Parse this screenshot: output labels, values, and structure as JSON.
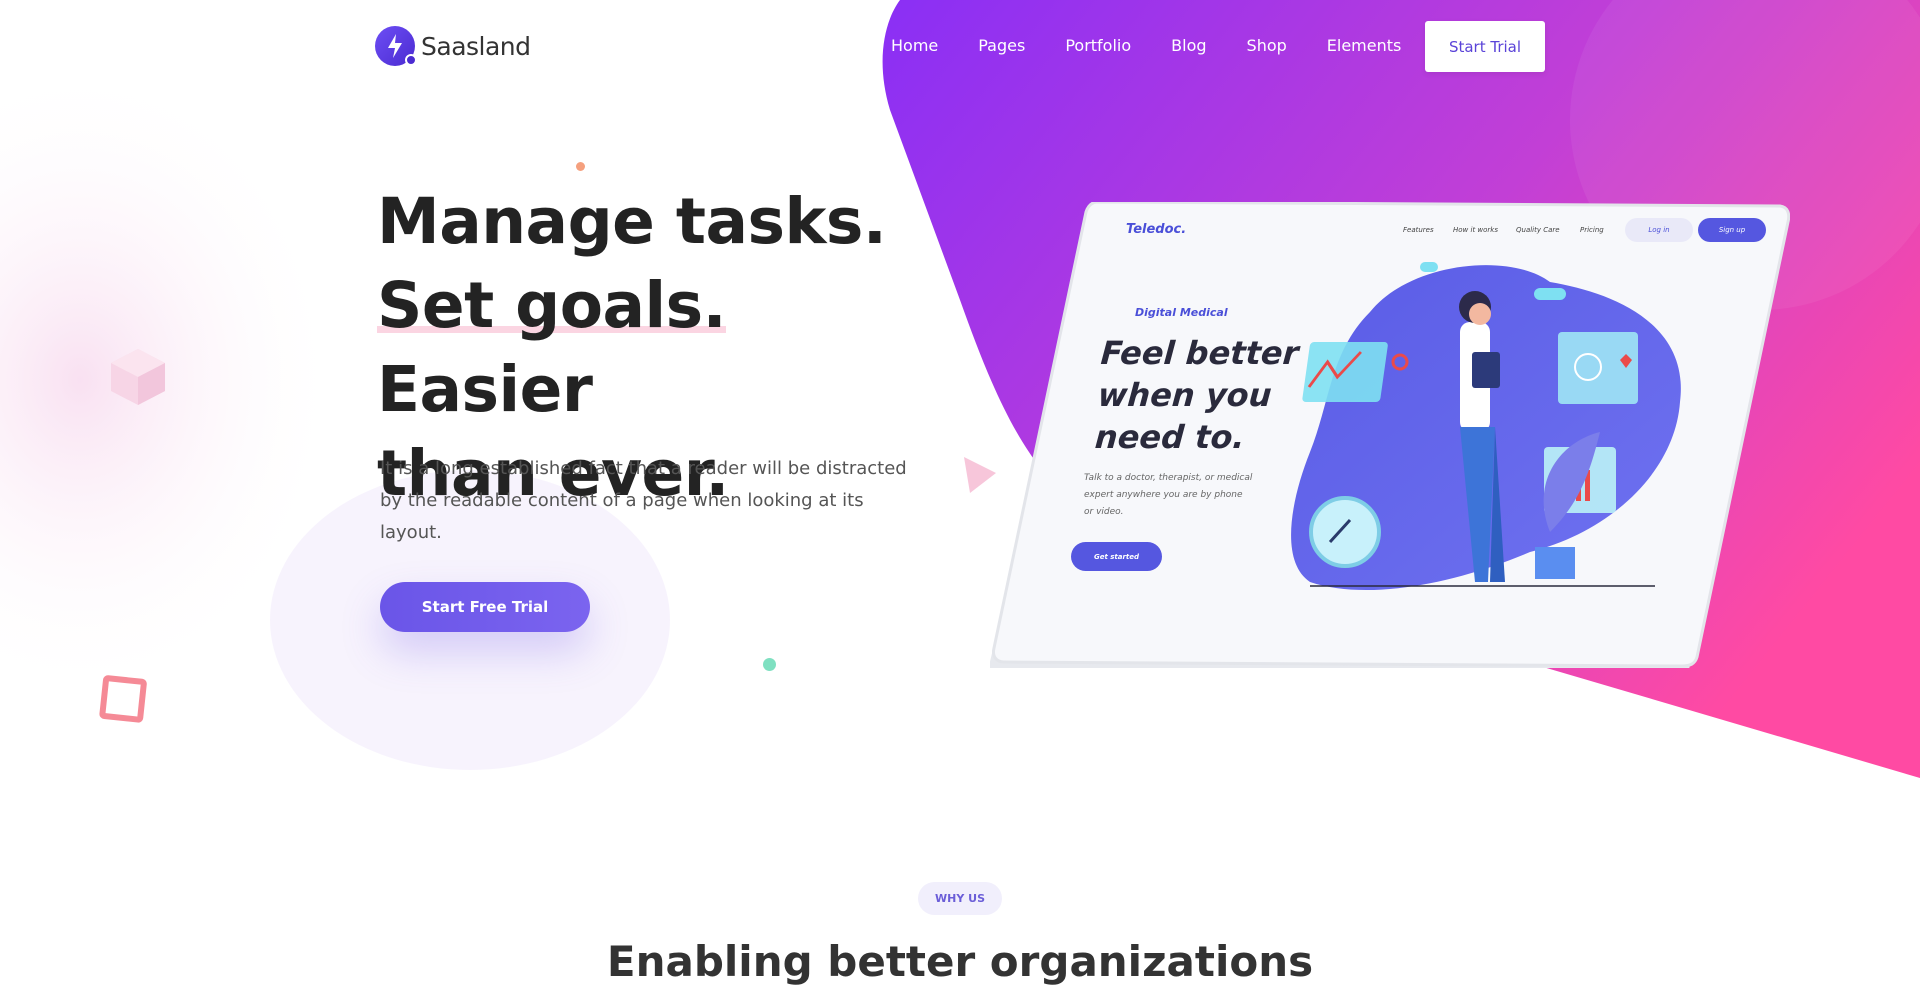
{
  "brand": {
    "name": "Saasland",
    "icon": "lightning-bolt-icon"
  },
  "nav": {
    "items": [
      "Home",
      "Pages",
      "Portfolio",
      "Blog",
      "Shop",
      "Elements"
    ],
    "cta": "Start Trial"
  },
  "hero": {
    "title_line1": "Manage tasks.",
    "title_highlight": "Set goals.",
    "title_line2_rest": " Easier",
    "title_line3": "than ever.",
    "description": "It is a long established fact that a reader will be distracted by the readable content of a page when looking at its layout.",
    "cta": "Start Free Trial"
  },
  "mockup": {
    "logo": "Teledoc.",
    "nav": [
      "Features",
      "How it works",
      "Quality Care",
      "Pricing"
    ],
    "login": "Log in",
    "signup": "Sign up",
    "kicker": "Digital Medical",
    "title": "Feel better when you need to.",
    "subtitle": "Talk to a doctor, therapist, or medical expert anywhere you are by phone or video.",
    "cta": "Get started"
  },
  "section": {
    "badge": "WHY US",
    "title": "Enabling better organizations"
  },
  "colors": {
    "gradient_start": "#8a2ff5",
    "gradient_end": "#ff4aa3",
    "accent": "#6a55e8",
    "text_dark": "#232323"
  }
}
